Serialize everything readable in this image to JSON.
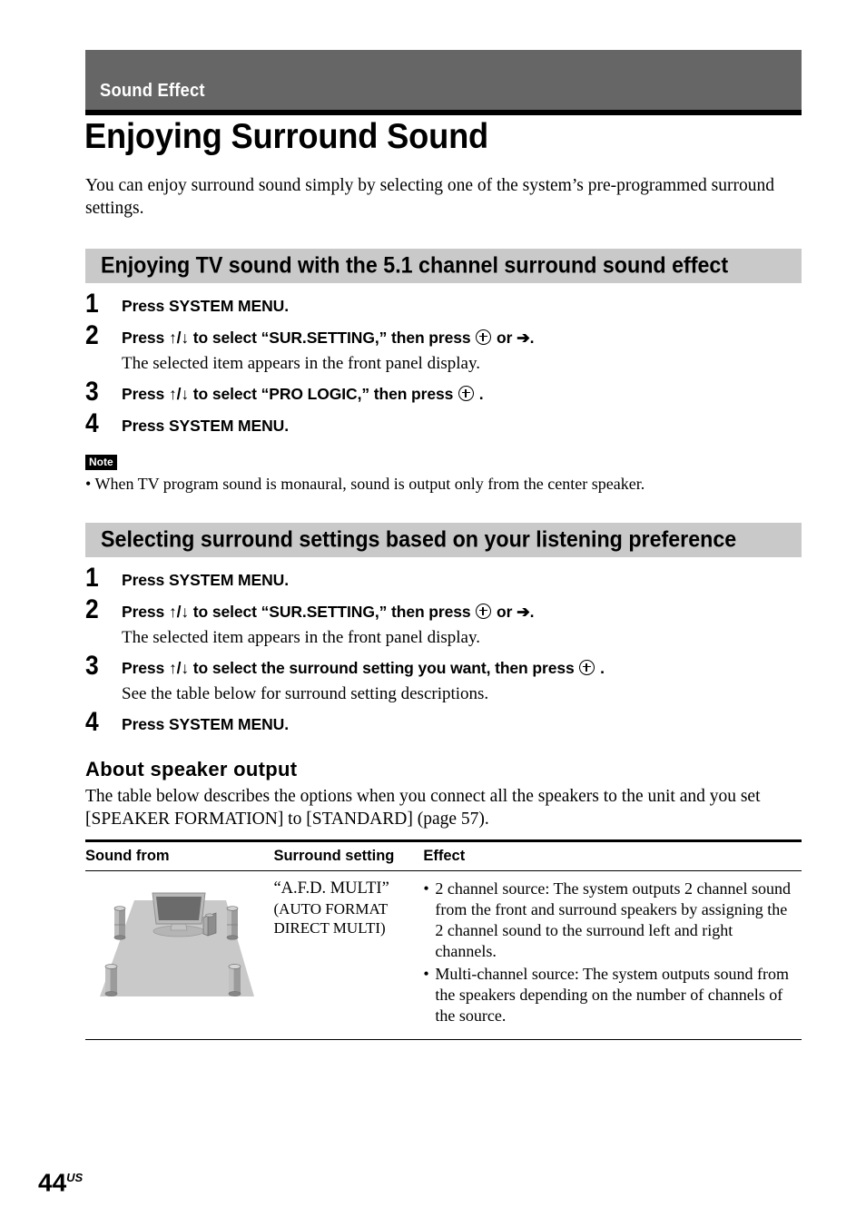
{
  "chapter": {
    "label": "Sound Effect",
    "band_color": "#666666"
  },
  "title": "Enjoying Surround Sound",
  "intro": "You can enjoy surround sound simply by selecting one of the system’s pre-programmed surround settings.",
  "sections": [
    {
      "heading": "Enjoying TV sound with the 5.1 channel surround sound effect",
      "bar_color": "#c9c9c9",
      "steps": [
        {
          "num": "1",
          "title_pre": "Press SYSTEM MENU.",
          "title_post": "",
          "desc": ""
        },
        {
          "num": "2",
          "title_pre": "Press ↑/↓ to select “SUR.SETTING,” then press",
          "title_post": "or ➔.",
          "desc": "The selected item appears in the front panel display."
        },
        {
          "num": "3",
          "title_pre": "Press ↑/↓ to select “PRO LOGIC,” then press",
          "title_post": ".",
          "desc": ""
        },
        {
          "num": "4",
          "title_pre": "Press SYSTEM MENU.",
          "title_post": "",
          "desc": ""
        }
      ]
    },
    {
      "heading": "Selecting surround settings based on your listening preference",
      "bar_color": "#c9c9c9",
      "steps": [
        {
          "num": "1",
          "title_pre": "Press SYSTEM MENU.",
          "title_post": "",
          "desc": ""
        },
        {
          "num": "2",
          "title_pre": "Press ↑/↓ to select “SUR.SETTING,” then press",
          "title_post": "or ➔.",
          "desc": "The selected item appears in the front panel display."
        },
        {
          "num": "3",
          "title_pre": "Press ↑/↓ to select the surround setting you want, then press",
          "title_post": ".",
          "desc": "See the table below for surround setting descriptions."
        },
        {
          "num": "4",
          "title_pre": "Press SYSTEM MENU.",
          "title_post": "",
          "desc": ""
        }
      ]
    }
  ],
  "note": {
    "badge": "Note",
    "text": "• When TV program sound is monaural, sound is output only from the center speaker."
  },
  "about": {
    "heading": "About speaker output",
    "text": "The table below describes the options when you connect all the speakers to the unit and you set [SPEAKER FORMATION] to [STANDARD] (page 57)."
  },
  "table": {
    "headers": [
      "Sound from",
      "Surround setting",
      "Effect"
    ],
    "rows": [
      {
        "diagram": "surround-room-5-1-diagram",
        "setting_name": "“A.F.D. MULTI”",
        "setting_expand": "(AUTO FORMAT DIRECT MULTI)",
        "effects": [
          "2 channel source: The system outputs 2 channel sound from the front and surround speakers by assigning the 2 channel sound to the surround left and right channels.",
          "Multi-channel source: The system outputs sound from the speakers depending on the number of channels of the source."
        ]
      }
    ]
  },
  "footer": {
    "page_number": "44",
    "page_suffix": "US"
  }
}
